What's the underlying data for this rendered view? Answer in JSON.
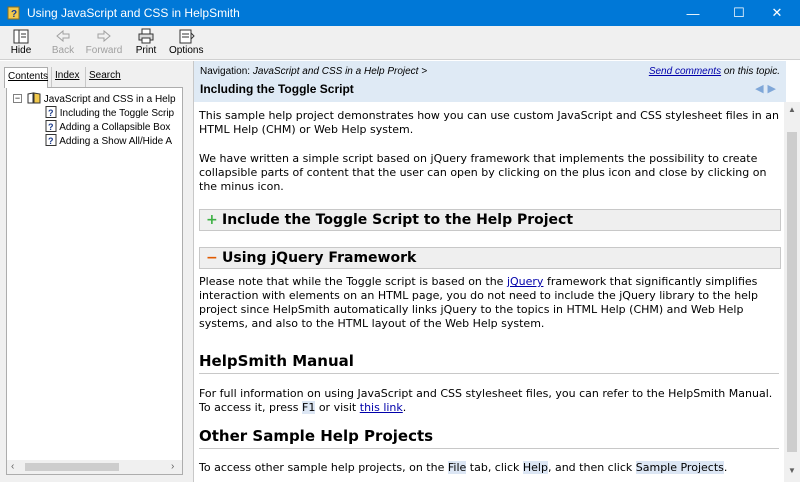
{
  "window": {
    "title": "Using JavaScript and CSS in HelpSmith",
    "minimize_glyph": "—",
    "maximize_glyph": "☐",
    "close_glyph": "✕"
  },
  "toolbar": {
    "hide": "Hide",
    "back": "Back",
    "forward": "Forward",
    "print": "Print",
    "options": "Options"
  },
  "left": {
    "tabs": [
      "Contents",
      "Index",
      "Search"
    ],
    "active_tab": "Contents",
    "tree": {
      "root": "JavaScript and CSS in a Help",
      "children": [
        "Including the Toggle Scrip",
        "Adding a Collapsible Box",
        "Adding a Show All/Hide A"
      ]
    }
  },
  "nav": {
    "prefix": "Navigation: ",
    "path": "JavaScript and CSS in a Help Project >",
    "send_link": "Send comments",
    "send_suffix": " on this topic.",
    "page_title": "Including the Toggle Script"
  },
  "content": {
    "p1": "This sample help project demonstrates how you can use custom JavaScript and CSS stylesheet files in an HTML Help (CHM) or Web Help system.",
    "p2": "We have written a simple script based on jQuery framework that implements the possibility to create collapsible parts of content that the user can open by clicking on the plus icon and close by clicking on the minus icon.",
    "box1": {
      "symbol": "+",
      "title": "Include the Toggle Script to the Help Project",
      "symbol_color": "#3cb043"
    },
    "box2": {
      "symbol": "−",
      "title": "Using jQuery Framework",
      "symbol_color": "#e05a00"
    },
    "p3_a": "Please note that while the Toggle script is based on the ",
    "p3_link": "jQuery",
    "p3_b": " framework that significantly simplifies interaction with elements on an HTML page, you do not need to include the jQuery library to the help project since HelpSmith automatically links jQuery to the topics in HTML Help (CHM) and Web Help systems, and also to the HTML layout of the Web Help system.",
    "h_manual": "HelpSmith Manual",
    "p4_a": "For full information on using JavaScript and CSS stylesheet files, you can refer to the HelpSmith Manual. To access it, press ",
    "p4_key": "F1",
    "p4_b": " or visit ",
    "p4_link": "this link",
    "p4_c": ".",
    "h_other": "Other Sample Help Projects",
    "p5_a": "To access other sample help projects, on the ",
    "p5_file": "File",
    "p5_b": " tab, click ",
    "p5_help": "Help",
    "p5_c": ", and then click ",
    "p5_samples": "Sample Projects",
    "p5_d": "."
  },
  "colors": {
    "titlebar": "#0078d7",
    "nav_bg": "#dfeaf5",
    "link": "#0000aa"
  }
}
